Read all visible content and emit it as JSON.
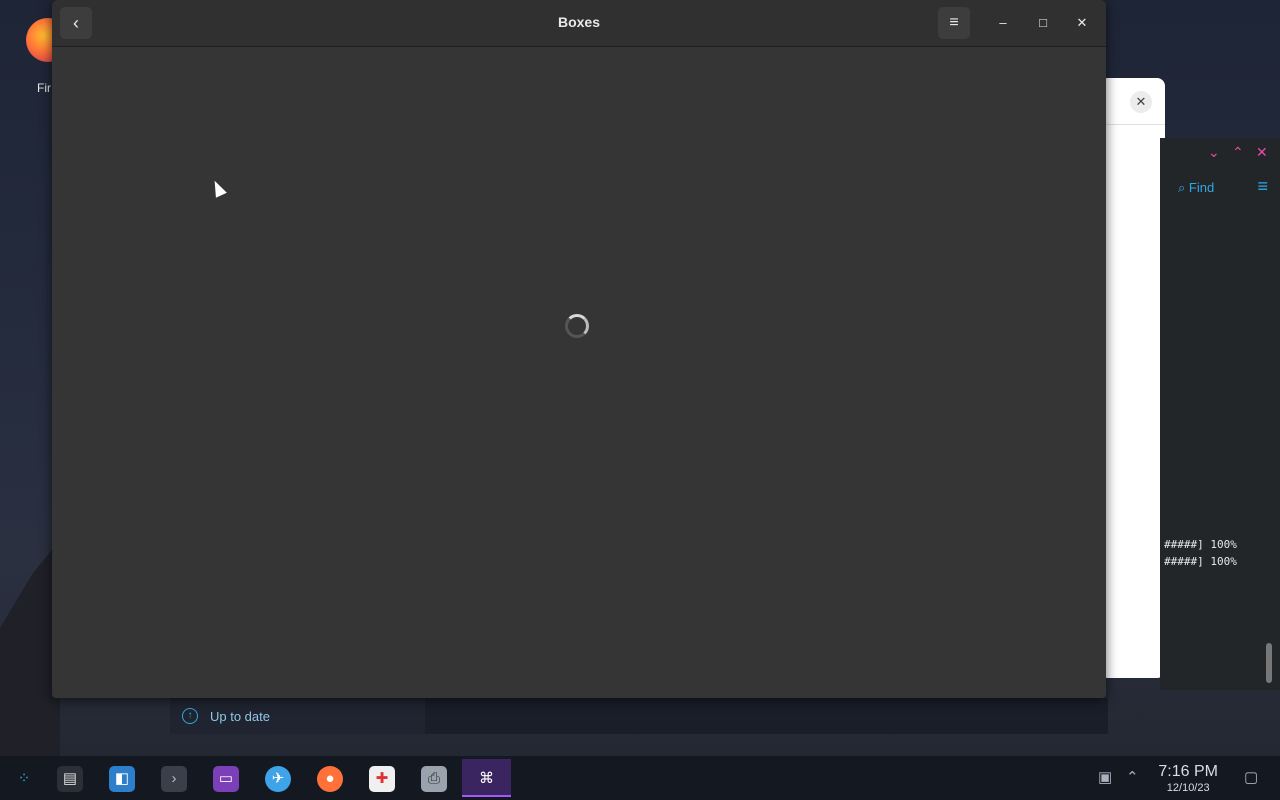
{
  "desktop": {
    "firefox_label": "Fir"
  },
  "boxes": {
    "title": "Boxes",
    "back_icon": "‹",
    "menu_icon": "≡",
    "minimize_icon": "–",
    "maximize_icon": "□",
    "close_icon": "✕"
  },
  "background_dialog": {
    "close_icon": "✕"
  },
  "terminal": {
    "find_label": "Find",
    "line1": "#####] 100%",
    "line2": "#####] 100%"
  },
  "discover": {
    "status": "Up to date"
  },
  "taskbar": {
    "time": "7:16 PM",
    "date": "12/10/23",
    "apps": [
      "app-launcher",
      "system-settings",
      "discover",
      "konsole",
      "dolphin",
      "browser",
      "firefox",
      "store",
      "printer",
      "boxes"
    ]
  },
  "colors": {
    "window_bg": "#353535",
    "titlebar_bg": "#303030",
    "taskbar_bg": "#141821",
    "accent": "#a855f7"
  }
}
